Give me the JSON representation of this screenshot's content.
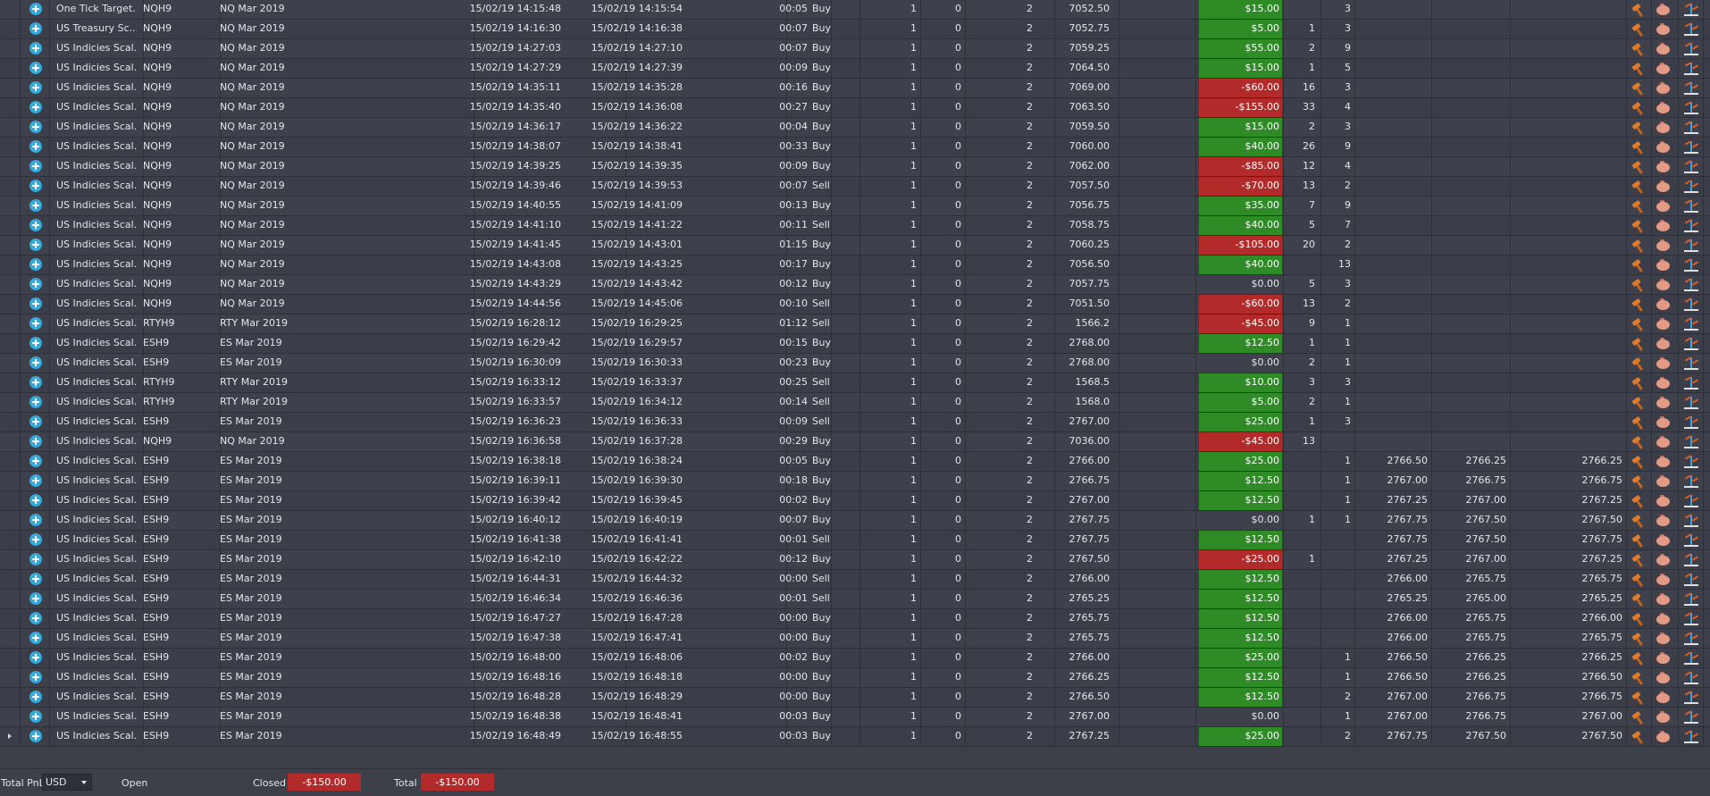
{
  "colors": {
    "profit": "#2e8b26",
    "loss": "#b22a2a",
    "icon_accent": "#35a9d9"
  },
  "row_icons": [
    "hammer-icon",
    "piggy-bank-icon",
    "scale-icon"
  ],
  "trades": [
    {
      "strategy": "One Tick Target...",
      "symbol": "NQH9",
      "instrument": "NQ Mar 2019",
      "entry": "15/02/19 14:15:48",
      "exit": "15/02/19 14:15:54",
      "duration": "00:05",
      "side": "Buy",
      "qty": "1",
      "c1": "0",
      "c2": "2",
      "price": "7052.50",
      "pnl": "$15.00",
      "pnl_sign": "pos",
      "m1": "",
      "m2": "3",
      "p1": "",
      "p2": "",
      "p3": ""
    },
    {
      "strategy": "US Treasury Sc...",
      "symbol": "NQH9",
      "instrument": "NQ Mar 2019",
      "entry": "15/02/19 14:16:30",
      "exit": "15/02/19 14:16:38",
      "duration": "00:07",
      "side": "Buy",
      "qty": "1",
      "c1": "0",
      "c2": "2",
      "price": "7052.75",
      "pnl": "$5.00",
      "pnl_sign": "pos",
      "m1": "1",
      "m2": "3",
      "p1": "",
      "p2": "",
      "p3": ""
    },
    {
      "strategy": "US Indicies Scal...",
      "symbol": "NQH9",
      "instrument": "NQ Mar 2019",
      "entry": "15/02/19 14:27:03",
      "exit": "15/02/19 14:27:10",
      "duration": "00:07",
      "side": "Buy",
      "qty": "1",
      "c1": "0",
      "c2": "2",
      "price": "7059.25",
      "pnl": "$55.00",
      "pnl_sign": "pos",
      "m1": "2",
      "m2": "9",
      "p1": "",
      "p2": "",
      "p3": ""
    },
    {
      "strategy": "US Indicies Scal...",
      "symbol": "NQH9",
      "instrument": "NQ Mar 2019",
      "entry": "15/02/19 14:27:29",
      "exit": "15/02/19 14:27:39",
      "duration": "00:09",
      "side": "Buy",
      "qty": "1",
      "c1": "0",
      "c2": "2",
      "price": "7064.50",
      "pnl": "$15.00",
      "pnl_sign": "pos",
      "m1": "1",
      "m2": "5",
      "p1": "",
      "p2": "",
      "p3": ""
    },
    {
      "strategy": "US Indicies Scal...",
      "symbol": "NQH9",
      "instrument": "NQ Mar 2019",
      "entry": "15/02/19 14:35:11",
      "exit": "15/02/19 14:35:28",
      "duration": "00:16",
      "side": "Buy",
      "qty": "1",
      "c1": "0",
      "c2": "2",
      "price": "7069.00",
      "pnl": "-$60.00",
      "pnl_sign": "neg",
      "m1": "16",
      "m2": "3",
      "p1": "",
      "p2": "",
      "p3": ""
    },
    {
      "strategy": "US Indicies Scal...",
      "symbol": "NQH9",
      "instrument": "NQ Mar 2019",
      "entry": "15/02/19 14:35:40",
      "exit": "15/02/19 14:36:08",
      "duration": "00:27",
      "side": "Buy",
      "qty": "1",
      "c1": "0",
      "c2": "2",
      "price": "7063.50",
      "pnl": "-$155.00",
      "pnl_sign": "neg",
      "m1": "33",
      "m2": "4",
      "p1": "",
      "p2": "",
      "p3": ""
    },
    {
      "strategy": "US Indicies Scal...",
      "symbol": "NQH9",
      "instrument": "NQ Mar 2019",
      "entry": "15/02/19 14:36:17",
      "exit": "15/02/19 14:36:22",
      "duration": "00:04",
      "side": "Buy",
      "qty": "1",
      "c1": "0",
      "c2": "2",
      "price": "7059.50",
      "pnl": "$15.00",
      "pnl_sign": "pos",
      "m1": "2",
      "m2": "3",
      "p1": "",
      "p2": "",
      "p3": ""
    },
    {
      "strategy": "US Indicies Scal...",
      "symbol": "NQH9",
      "instrument": "NQ Mar 2019",
      "entry": "15/02/19 14:38:07",
      "exit": "15/02/19 14:38:41",
      "duration": "00:33",
      "side": "Buy",
      "qty": "1",
      "c1": "0",
      "c2": "2",
      "price": "7060.00",
      "pnl": "$40.00",
      "pnl_sign": "pos",
      "m1": "26",
      "m2": "9",
      "p1": "",
      "p2": "",
      "p3": ""
    },
    {
      "strategy": "US Indicies Scal...",
      "symbol": "NQH9",
      "instrument": "NQ Mar 2019",
      "entry": "15/02/19 14:39:25",
      "exit": "15/02/19 14:39:35",
      "duration": "00:09",
      "side": "Buy",
      "qty": "1",
      "c1": "0",
      "c2": "2",
      "price": "7062.00",
      "pnl": "-$85.00",
      "pnl_sign": "neg",
      "m1": "12",
      "m2": "4",
      "p1": "",
      "p2": "",
      "p3": ""
    },
    {
      "strategy": "US Indicies Scal...",
      "symbol": "NQH9",
      "instrument": "NQ Mar 2019",
      "entry": "15/02/19 14:39:46",
      "exit": "15/02/19 14:39:53",
      "duration": "00:07",
      "side": "Sell",
      "qty": "1",
      "c1": "0",
      "c2": "2",
      "price": "7057.50",
      "pnl": "-$70.00",
      "pnl_sign": "neg",
      "m1": "13",
      "m2": "2",
      "p1": "",
      "p2": "",
      "p3": ""
    },
    {
      "strategy": "US Indicies Scal...",
      "symbol": "NQH9",
      "instrument": "NQ Mar 2019",
      "entry": "15/02/19 14:40:55",
      "exit": "15/02/19 14:41:09",
      "duration": "00:13",
      "side": "Buy",
      "qty": "1",
      "c1": "0",
      "c2": "2",
      "price": "7056.75",
      "pnl": "$35.00",
      "pnl_sign": "pos",
      "m1": "7",
      "m2": "9",
      "p1": "",
      "p2": "",
      "p3": ""
    },
    {
      "strategy": "US Indicies Scal...",
      "symbol": "NQH9",
      "instrument": "NQ Mar 2019",
      "entry": "15/02/19 14:41:10",
      "exit": "15/02/19 14:41:22",
      "duration": "00:11",
      "side": "Sell",
      "qty": "1",
      "c1": "0",
      "c2": "2",
      "price": "7058.75",
      "pnl": "$40.00",
      "pnl_sign": "pos",
      "m1": "5",
      "m2": "7",
      "p1": "",
      "p2": "",
      "p3": ""
    },
    {
      "strategy": "US Indicies Scal...",
      "symbol": "NQH9",
      "instrument": "NQ Mar 2019",
      "entry": "15/02/19 14:41:45",
      "exit": "15/02/19 14:43:01",
      "duration": "01:15",
      "side": "Buy",
      "qty": "1",
      "c1": "0",
      "c2": "2",
      "price": "7060.25",
      "pnl": "-$105.00",
      "pnl_sign": "neg",
      "m1": "20",
      "m2": "2",
      "p1": "",
      "p2": "",
      "p3": ""
    },
    {
      "strategy": "US Indicies Scal...",
      "symbol": "NQH9",
      "instrument": "NQ Mar 2019",
      "entry": "15/02/19 14:43:08",
      "exit": "15/02/19 14:43:25",
      "duration": "00:17",
      "side": "Buy",
      "qty": "1",
      "c1": "0",
      "c2": "2",
      "price": "7056.50",
      "pnl": "$40.00",
      "pnl_sign": "pos",
      "m1": "",
      "m2": "13",
      "p1": "",
      "p2": "",
      "p3": ""
    },
    {
      "strategy": "US Indicies Scal...",
      "symbol": "NQH9",
      "instrument": "NQ Mar 2019",
      "entry": "15/02/19 14:43:29",
      "exit": "15/02/19 14:43:42",
      "duration": "00:12",
      "side": "Buy",
      "qty": "1",
      "c1": "0",
      "c2": "2",
      "price": "7057.75",
      "pnl": "$0.00",
      "pnl_sign": "zero",
      "m1": "5",
      "m2": "3",
      "p1": "",
      "p2": "",
      "p3": ""
    },
    {
      "strategy": "US Indicies Scal...",
      "symbol": "NQH9",
      "instrument": "NQ Mar 2019",
      "entry": "15/02/19 14:44:56",
      "exit": "15/02/19 14:45:06",
      "duration": "00:10",
      "side": "Sell",
      "qty": "1",
      "c1": "0",
      "c2": "2",
      "price": "7051.50",
      "pnl": "-$60.00",
      "pnl_sign": "neg",
      "m1": "13",
      "m2": "2",
      "p1": "",
      "p2": "",
      "p3": ""
    },
    {
      "strategy": "US Indicies Scal...",
      "symbol": "RTYH9",
      "instrument": "RTY Mar 2019",
      "entry": "15/02/19 16:28:12",
      "exit": "15/02/19 16:29:25",
      "duration": "01:12",
      "side": "Sell",
      "qty": "1",
      "c1": "0",
      "c2": "2",
      "price": "1566.2",
      "pnl": "-$45.00",
      "pnl_sign": "neg",
      "m1": "9",
      "m2": "1",
      "p1": "",
      "p2": "",
      "p3": ""
    },
    {
      "strategy": "US Indicies Scal...",
      "symbol": "ESH9",
      "instrument": "ES Mar 2019",
      "entry": "15/02/19 16:29:42",
      "exit": "15/02/19 16:29:57",
      "duration": "00:15",
      "side": "Buy",
      "qty": "1",
      "c1": "0",
      "c2": "2",
      "price": "2768.00",
      "pnl": "$12.50",
      "pnl_sign": "pos",
      "m1": "1",
      "m2": "1",
      "p1": "",
      "p2": "",
      "p3": ""
    },
    {
      "strategy": "US Indicies Scal...",
      "symbol": "ESH9",
      "instrument": "ES Mar 2019",
      "entry": "15/02/19 16:30:09",
      "exit": "15/02/19 16:30:33",
      "duration": "00:23",
      "side": "Buy",
      "qty": "1",
      "c1": "0",
      "c2": "2",
      "price": "2768.00",
      "pnl": "$0.00",
      "pnl_sign": "zero",
      "m1": "2",
      "m2": "1",
      "p1": "",
      "p2": "",
      "p3": ""
    },
    {
      "strategy": "US Indicies Scal...",
      "symbol": "RTYH9",
      "instrument": "RTY Mar 2019",
      "entry": "15/02/19 16:33:12",
      "exit": "15/02/19 16:33:37",
      "duration": "00:25",
      "side": "Sell",
      "qty": "1",
      "c1": "0",
      "c2": "2",
      "price": "1568.5",
      "pnl": "$10.00",
      "pnl_sign": "pos",
      "m1": "3",
      "m2": "3",
      "p1": "",
      "p2": "",
      "p3": ""
    },
    {
      "strategy": "US Indicies Scal...",
      "symbol": "RTYH9",
      "instrument": "RTY Mar 2019",
      "entry": "15/02/19 16:33:57",
      "exit": "15/02/19 16:34:12",
      "duration": "00:14",
      "side": "Sell",
      "qty": "1",
      "c1": "0",
      "c2": "2",
      "price": "1568.0",
      "pnl": "$5.00",
      "pnl_sign": "pos",
      "m1": "2",
      "m2": "1",
      "p1": "",
      "p2": "",
      "p3": ""
    },
    {
      "strategy": "US Indicies Scal...",
      "symbol": "ESH9",
      "instrument": "ES Mar 2019",
      "entry": "15/02/19 16:36:23",
      "exit": "15/02/19 16:36:33",
      "duration": "00:09",
      "side": "Sell",
      "qty": "1",
      "c1": "0",
      "c2": "2",
      "price": "2767.00",
      "pnl": "$25.00",
      "pnl_sign": "pos",
      "m1": "1",
      "m2": "3",
      "p1": "",
      "p2": "",
      "p3": ""
    },
    {
      "strategy": "US Indicies Scal...",
      "symbol": "NQH9",
      "instrument": "NQ Mar 2019",
      "entry": "15/02/19 16:36:58",
      "exit": "15/02/19 16:37:28",
      "duration": "00:29",
      "side": "Buy",
      "qty": "1",
      "c1": "0",
      "c2": "2",
      "price": "7036.00",
      "pnl": "-$45.00",
      "pnl_sign": "neg",
      "m1": "13",
      "m2": "",
      "p1": "",
      "p2": "",
      "p3": ""
    },
    {
      "strategy": "US Indicies Scal...",
      "symbol": "ESH9",
      "instrument": "ES Mar 2019",
      "entry": "15/02/19 16:38:18",
      "exit": "15/02/19 16:38:24",
      "duration": "00:05",
      "side": "Buy",
      "qty": "1",
      "c1": "0",
      "c2": "2",
      "price": "2766.00",
      "pnl": "$25.00",
      "pnl_sign": "pos",
      "m1": "",
      "m2": "1",
      "p1": "2766.50",
      "p2": "2766.25",
      "p3": "2766.25"
    },
    {
      "strategy": "US Indicies Scal...",
      "symbol": "ESH9",
      "instrument": "ES Mar 2019",
      "entry": "15/02/19 16:39:11",
      "exit": "15/02/19 16:39:30",
      "duration": "00:18",
      "side": "Buy",
      "qty": "1",
      "c1": "0",
      "c2": "2",
      "price": "2766.75",
      "pnl": "$12.50",
      "pnl_sign": "pos",
      "m1": "",
      "m2": "1",
      "p1": "2767.00",
      "p2": "2766.75",
      "p3": "2766.75"
    },
    {
      "strategy": "US Indicies Scal...",
      "symbol": "ESH9",
      "instrument": "ES Mar 2019",
      "entry": "15/02/19 16:39:42",
      "exit": "15/02/19 16:39:45",
      "duration": "00:02",
      "side": "Buy",
      "qty": "1",
      "c1": "0",
      "c2": "2",
      "price": "2767.00",
      "pnl": "$12.50",
      "pnl_sign": "pos",
      "m1": "",
      "m2": "1",
      "p1": "2767.25",
      "p2": "2767.00",
      "p3": "2767.25"
    },
    {
      "strategy": "US Indicies Scal...",
      "symbol": "ESH9",
      "instrument": "ES Mar 2019",
      "entry": "15/02/19 16:40:12",
      "exit": "15/02/19 16:40:19",
      "duration": "00:07",
      "side": "Buy",
      "qty": "1",
      "c1": "0",
      "c2": "2",
      "price": "2767.75",
      "pnl": "$0.00",
      "pnl_sign": "zero",
      "m1": "1",
      "m2": "1",
      "p1": "2767.75",
      "p2": "2767.50",
      "p3": "2767.50"
    },
    {
      "strategy": "US Indicies Scal...",
      "symbol": "ESH9",
      "instrument": "ES Mar 2019",
      "entry": "15/02/19 16:41:38",
      "exit": "15/02/19 16:41:41",
      "duration": "00:01",
      "side": "Sell",
      "qty": "1",
      "c1": "0",
      "c2": "2",
      "price": "2767.75",
      "pnl": "$12.50",
      "pnl_sign": "pos",
      "m1": "",
      "m2": "",
      "p1": "2767.75",
      "p2": "2767.50",
      "p3": "2767.75"
    },
    {
      "strategy": "US Indicies Scal...",
      "symbol": "ESH9",
      "instrument": "ES Mar 2019",
      "entry": "15/02/19 16:42:10",
      "exit": "15/02/19 16:42:22",
      "duration": "00:12",
      "side": "Buy",
      "qty": "1",
      "c1": "0",
      "c2": "2",
      "price": "2767.50",
      "pnl": "-$25.00",
      "pnl_sign": "neg",
      "m1": "1",
      "m2": "",
      "p1": "2767.25",
      "p2": "2767.00",
      "p3": "2767.25"
    },
    {
      "strategy": "US Indicies Scal...",
      "symbol": "ESH9",
      "instrument": "ES Mar 2019",
      "entry": "15/02/19 16:44:31",
      "exit": "15/02/19 16:44:32",
      "duration": "00:00",
      "side": "Sell",
      "qty": "1",
      "c1": "0",
      "c2": "2",
      "price": "2766.00",
      "pnl": "$12.50",
      "pnl_sign": "pos",
      "m1": "",
      "m2": "",
      "p1": "2766.00",
      "p2": "2765.75",
      "p3": "2765.75"
    },
    {
      "strategy": "US Indicies Scal...",
      "symbol": "ESH9",
      "instrument": "ES Mar 2019",
      "entry": "15/02/19 16:46:34",
      "exit": "15/02/19 16:46:36",
      "duration": "00:01",
      "side": "Sell",
      "qty": "1",
      "c1": "0",
      "c2": "2",
      "price": "2765.25",
      "pnl": "$12.50",
      "pnl_sign": "pos",
      "m1": "",
      "m2": "",
      "p1": "2765.25",
      "p2": "2765.00",
      "p3": "2765.25"
    },
    {
      "strategy": "US Indicies Scal...",
      "symbol": "ESH9",
      "instrument": "ES Mar 2019",
      "entry": "15/02/19 16:47:27",
      "exit": "15/02/19 16:47:28",
      "duration": "00:00",
      "side": "Buy",
      "qty": "1",
      "c1": "0",
      "c2": "2",
      "price": "2765.75",
      "pnl": "$12.50",
      "pnl_sign": "pos",
      "m1": "",
      "m2": "",
      "p1": "2766.00",
      "p2": "2765.75",
      "p3": "2766.00"
    },
    {
      "strategy": "US Indicies Scal...",
      "symbol": "ESH9",
      "instrument": "ES Mar 2019",
      "entry": "15/02/19 16:47:38",
      "exit": "15/02/19 16:47:41",
      "duration": "00:00",
      "side": "Buy",
      "qty": "1",
      "c1": "0",
      "c2": "2",
      "price": "2765.75",
      "pnl": "$12.50",
      "pnl_sign": "pos",
      "m1": "",
      "m2": "",
      "p1": "2766.00",
      "p2": "2765.75",
      "p3": "2765.75"
    },
    {
      "strategy": "US Indicies Scal...",
      "symbol": "ESH9",
      "instrument": "ES Mar 2019",
      "entry": "15/02/19 16:48:00",
      "exit": "15/02/19 16:48:06",
      "duration": "00:02",
      "side": "Buy",
      "qty": "1",
      "c1": "0",
      "c2": "2",
      "price": "2766.00",
      "pnl": "$25.00",
      "pnl_sign": "pos",
      "m1": "",
      "m2": "1",
      "p1": "2766.50",
      "p2": "2766.25",
      "p3": "2766.25"
    },
    {
      "strategy": "US Indicies Scal...",
      "symbol": "ESH9",
      "instrument": "ES Mar 2019",
      "entry": "15/02/19 16:48:16",
      "exit": "15/02/19 16:48:18",
      "duration": "00:00",
      "side": "Buy",
      "qty": "1",
      "c1": "0",
      "c2": "2",
      "price": "2766.25",
      "pnl": "$12.50",
      "pnl_sign": "pos",
      "m1": "",
      "m2": "1",
      "p1": "2766.50",
      "p2": "2766.25",
      "p3": "2766.50"
    },
    {
      "strategy": "US Indicies Scal...",
      "symbol": "ESH9",
      "instrument": "ES Mar 2019",
      "entry": "15/02/19 16:48:28",
      "exit": "15/02/19 16:48:29",
      "duration": "00:00",
      "side": "Buy",
      "qty": "1",
      "c1": "0",
      "c2": "2",
      "price": "2766.50",
      "pnl": "$12.50",
      "pnl_sign": "pos",
      "m1": "",
      "m2": "2",
      "p1": "2767.00",
      "p2": "2766.75",
      "p3": "2766.75"
    },
    {
      "strategy": "US Indicies Scal...",
      "symbol": "ESH9",
      "instrument": "ES Mar 2019",
      "entry": "15/02/19 16:48:38",
      "exit": "15/02/19 16:48:41",
      "duration": "00:03",
      "side": "Buy",
      "qty": "1",
      "c1": "0",
      "c2": "2",
      "price": "2767.00",
      "pnl": "$0.00",
      "pnl_sign": "zero",
      "m1": "",
      "m2": "1",
      "p1": "2767.00",
      "p2": "2766.75",
      "p3": "2767.00"
    },
    {
      "strategy": "US Indicies Scal...",
      "symbol": "ESH9",
      "instrument": "ES Mar 2019",
      "entry": "15/02/19 16:48:49",
      "exit": "15/02/19 16:48:55",
      "duration": "00:03",
      "side": "Buy",
      "qty": "1",
      "c1": "0",
      "c2": "2",
      "price": "2767.25",
      "pnl": "$25.00",
      "pnl_sign": "pos",
      "m1": "",
      "m2": "2",
      "p1": "2767.75",
      "p2": "2767.50",
      "p3": "2767.50",
      "current": true
    }
  ],
  "footer": {
    "total_pnl_label": "Total PnL",
    "currency": "USD",
    "open_label": "Open",
    "closed_label": "Closed",
    "closed_value": "-$150.00",
    "total_label": "Total",
    "total_value": "-$150.00"
  }
}
